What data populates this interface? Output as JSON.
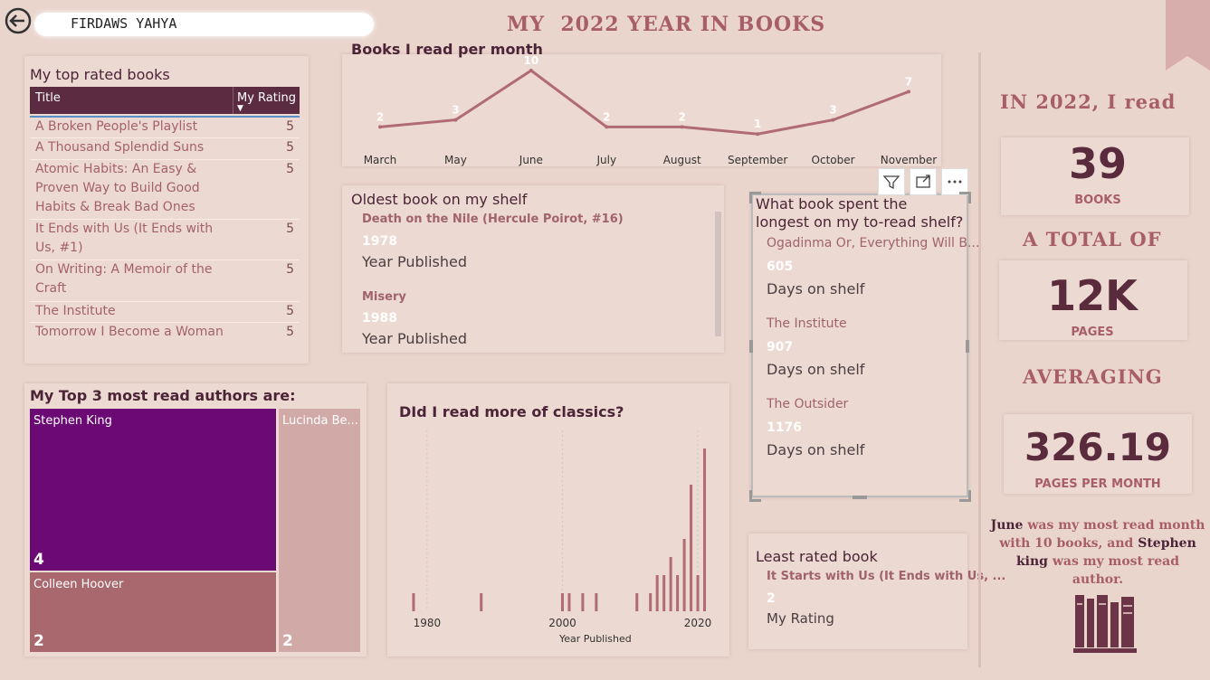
{
  "header": {
    "user_name": "FIRDAWS YAHYA",
    "report_title": "MY  2022 YEAR IN BOOKS"
  },
  "top_rated": {
    "title": "My top rated books",
    "col_title": "Title",
    "col_rating": "My Rating",
    "rows": [
      {
        "title": "A Broken People's Playlist",
        "rating": "5"
      },
      {
        "title": "A Thousand Splendid Suns",
        "rating": "5"
      },
      {
        "title": "Atomic Habits: An Easy & Proven Way to Build Good Habits & Break Bad Ones",
        "rating": "5"
      },
      {
        "title": "It Ends with Us (It Ends with Us, #1)",
        "rating": "5"
      },
      {
        "title": "On Writing: A Memoir of the Craft",
        "rating": "5"
      },
      {
        "title": "The Institute",
        "rating": "5"
      },
      {
        "title": "Tomorrow I Become a Woman",
        "rating": "5"
      }
    ]
  },
  "books_per_month": {
    "title": "Books I read per month",
    "chart_data": {
      "type": "line",
      "categories": [
        "March",
        "May",
        "June",
        "July",
        "August",
        "September",
        "October",
        "November"
      ],
      "values": [
        2,
        3,
        10,
        2,
        2,
        1,
        3,
        7
      ],
      "color": "#b06b73"
    }
  },
  "oldest": {
    "title": "Oldest book on my shelf",
    "items": [
      {
        "book": "Death on the Nile (Hercule Poirot, #16)",
        "year": "1978",
        "label": "Year Published"
      },
      {
        "book": "Misery",
        "year": "1988",
        "label": "Year Published"
      }
    ]
  },
  "longest": {
    "title": "What book spent the longest on my to-read shelf?",
    "items": [
      {
        "book": "Ogadinma Or, Everything Will B...",
        "days": "605",
        "label": "Days on shelf"
      },
      {
        "book": "The Institute",
        "days": "907",
        "label": "Days on shelf"
      },
      {
        "book": "The Outsider",
        "days": "1176",
        "label": "Days on shelf"
      }
    ]
  },
  "least": {
    "title": "Least rated book",
    "book": "It Starts with Us (It Ends with Us, ...",
    "rating": "2",
    "label": "My Rating"
  },
  "authors": {
    "title": "My Top 3 most read authors are:",
    "chart_data": {
      "type": "treemap",
      "items": [
        {
          "name": "Stephen King",
          "value": 4,
          "color": "#6b0a74"
        },
        {
          "name": "Colleen Hoover",
          "value": 2,
          "color": "#a9676e"
        },
        {
          "name": "Lucinda Be...",
          "value": 2,
          "color": "#d1aaa7"
        }
      ]
    }
  },
  "classics": {
    "title": "DId I read more of classics?",
    "chart_data": {
      "type": "bar",
      "xlabel": "Year Published",
      "xticks": [
        1980,
        2000,
        2020
      ],
      "xlim": [
        1976,
        2022
      ],
      "ymax": 10,
      "points": [
        {
          "year": 1978,
          "count": 1
        },
        {
          "year": 1988,
          "count": 1
        },
        {
          "year": 2000,
          "count": 1
        },
        {
          "year": 2001,
          "count": 1
        },
        {
          "year": 2003,
          "count": 1
        },
        {
          "year": 2005,
          "count": 1
        },
        {
          "year": 2011,
          "count": 1
        },
        {
          "year": 2013,
          "count": 1
        },
        {
          "year": 2014,
          "count": 2
        },
        {
          "year": 2015,
          "count": 2
        },
        {
          "year": 2016,
          "count": 3
        },
        {
          "year": 2017,
          "count": 2
        },
        {
          "year": 2018,
          "count": 4
        },
        {
          "year": 2019,
          "count": 7
        },
        {
          "year": 2020,
          "count": 2
        },
        {
          "year": 2021,
          "count": 9
        }
      ],
      "color": "#b06b73"
    }
  },
  "summary": {
    "intro": "IN 2022, I read",
    "books_num": "39",
    "books_lbl": "BOOKS",
    "total": "A TOTAL OF",
    "pages_num": "12K",
    "pages_lbl": "PAGES",
    "avg": "AVERAGING",
    "avg_num": "326.19",
    "avg_lbl": "PAGES PER MONTH",
    "sentence": {
      "month": "June",
      "p1": " was my most read month with 10 books, and ",
      "author": "Stephen king",
      "p2": " was my most read author."
    }
  }
}
